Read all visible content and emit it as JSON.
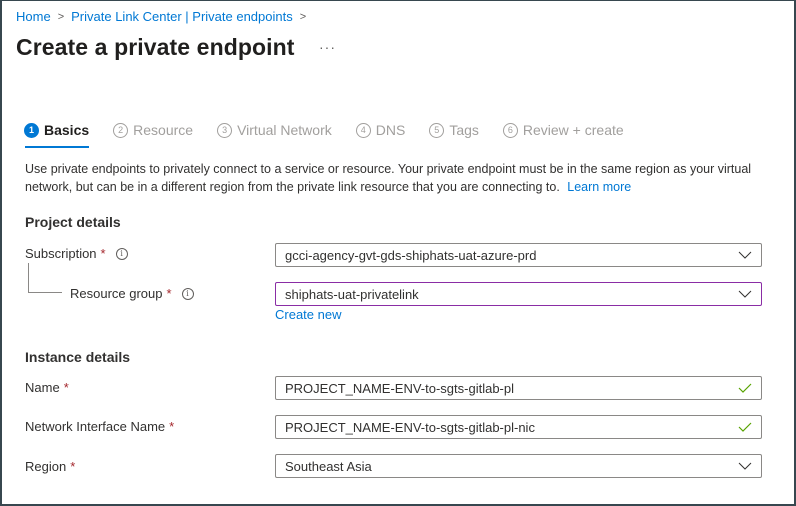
{
  "breadcrumb": [
    {
      "label": "Home"
    },
    {
      "label": "Private Link Center | Private endpoints"
    }
  ],
  "page_title": "Create a private endpoint",
  "more_label": "···",
  "tabs": [
    {
      "num": "1",
      "label": "Basics",
      "active": true
    },
    {
      "num": "2",
      "label": "Resource",
      "active": false
    },
    {
      "num": "3",
      "label": "Virtual Network",
      "active": false
    },
    {
      "num": "4",
      "label": "DNS",
      "active": false
    },
    {
      "num": "5",
      "label": "Tags",
      "active": false
    },
    {
      "num": "6",
      "label": "Review + create",
      "active": false
    }
  ],
  "description": {
    "text": "Use private endpoints to privately connect to a service or resource. Your private endpoint must be in the same region as your virtual network, but can be in a different region from the private link resource that you are connecting to.",
    "learn_more": "Learn more"
  },
  "project_details": {
    "heading": "Project details",
    "subscription": {
      "label": "Subscription",
      "required": "*",
      "value": "gcci-agency-gvt-gds-shiphats-uat-azure-prd"
    },
    "resource_group": {
      "label": "Resource group",
      "required": "*",
      "value": "shiphats-uat-privatelink",
      "create_new": "Create new"
    }
  },
  "instance_details": {
    "heading": "Instance details",
    "name": {
      "label": "Name",
      "required": "*",
      "value": "PROJECT_NAME-ENV-to-sgts-gitlab-pl"
    },
    "nic_name": {
      "label": "Network Interface Name",
      "required": "*",
      "value": "PROJECT_NAME-ENV-to-sgts-gitlab-pl-nic"
    },
    "region": {
      "label": "Region",
      "required": "*",
      "value": "Southeast Asia"
    }
  },
  "colors": {
    "accent": "#0078d4",
    "required": "#a4262c",
    "valid": "#57a300",
    "focus_border": "#8a2da5"
  }
}
